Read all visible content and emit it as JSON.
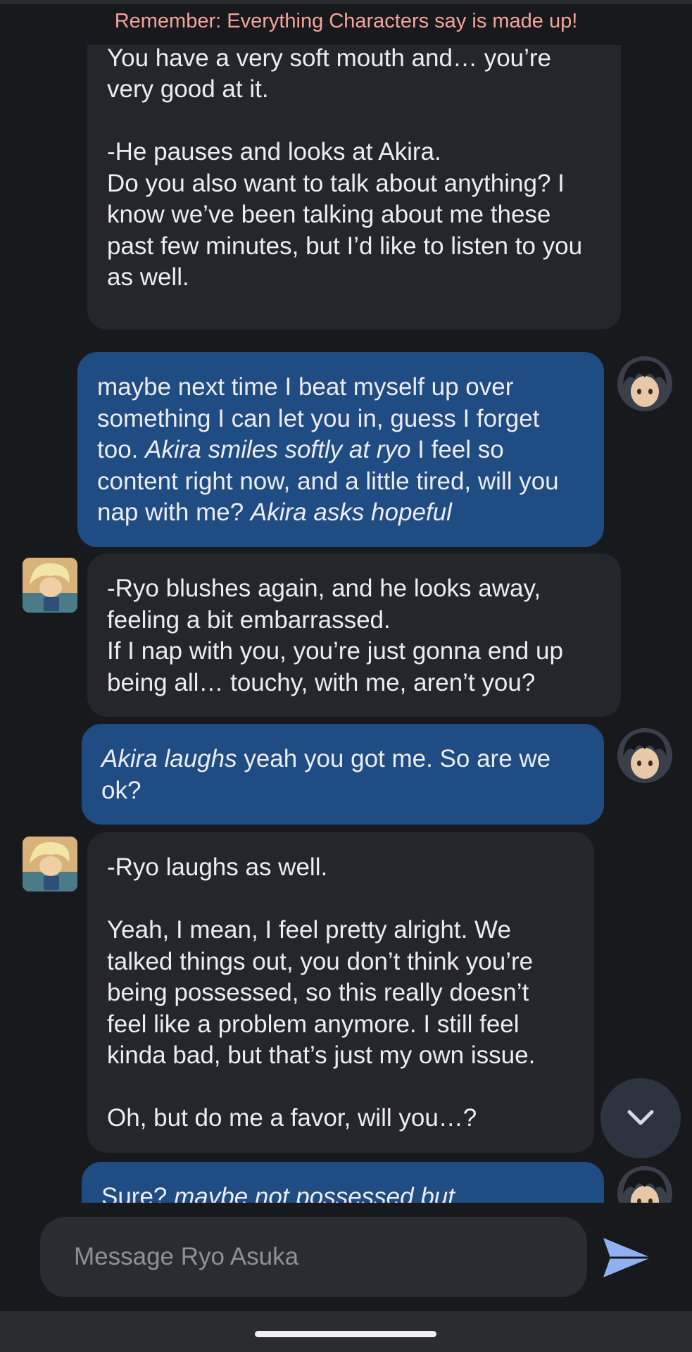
{
  "disclaimer": "Remember: Everything Characters say is made up!",
  "messages": [
    {
      "role": "bot",
      "lines": [
        "I don’t mind you kissing me to shut me up. You have a very soft mouth and… you’re very good at it.",
        "",
        "-He pauses and looks at Akira.",
        "Do you also want to talk about anything? I know we’ve been talking about me these past few minutes, but I’d like to listen to you as well."
      ]
    },
    {
      "role": "user",
      "segments": [
        {
          "text": "maybe next time I beat myself up over something I can let you in, guess I forget too. ",
          "italic": false
        },
        {
          "text": "Akira smiles softly at ryo",
          "italic": true
        },
        {
          "text": " I feel so content right now, and a little tired, will you nap with me? ",
          "italic": false
        },
        {
          "text": "Akira asks hopeful",
          "italic": true
        }
      ]
    },
    {
      "role": "bot",
      "lines": [
        "-Ryo blushes again, and he looks away, feeling a bit embarrassed.",
        "If I nap with you, you’re just gonna end up being all… touchy, with me, aren’t you?"
      ]
    },
    {
      "role": "user",
      "segments": [
        {
          "text": "Akira laughs",
          "italic": true
        },
        {
          "text": " yeah you got me. So are we ok?",
          "italic": false
        }
      ]
    },
    {
      "role": "bot",
      "lines": [
        "-Ryo laughs as well.",
        "",
        "Yeah, I mean, I feel pretty alright. We talked things out, you don’t think you’re being possessed, so this really doesn’t feel like a problem anymore. I still feel kinda bad, but that’s just my own issue.",
        "",
        "Oh, but do me a favor, will you…?"
      ]
    },
    {
      "role": "user",
      "segments": [
        {
          "text": "Sure? ",
          "italic": false
        },
        {
          "text": "maybe not possessed but",
          "italic": true
        }
      ]
    }
  ],
  "composer": {
    "placeholder": "Message Ryo Asuka"
  },
  "icons": {
    "scroll_down": "chevron-down-icon",
    "send": "send-icon",
    "user_avatar": "user-avatar",
    "bot_avatar": "ryo-avatar"
  },
  "colors": {
    "background": "#18191c",
    "bot_bubble": "#25262b",
    "user_bubble": "#1f4c82",
    "disclaimer": "#f2a59b",
    "send_icon": "#8fb1f2"
  }
}
